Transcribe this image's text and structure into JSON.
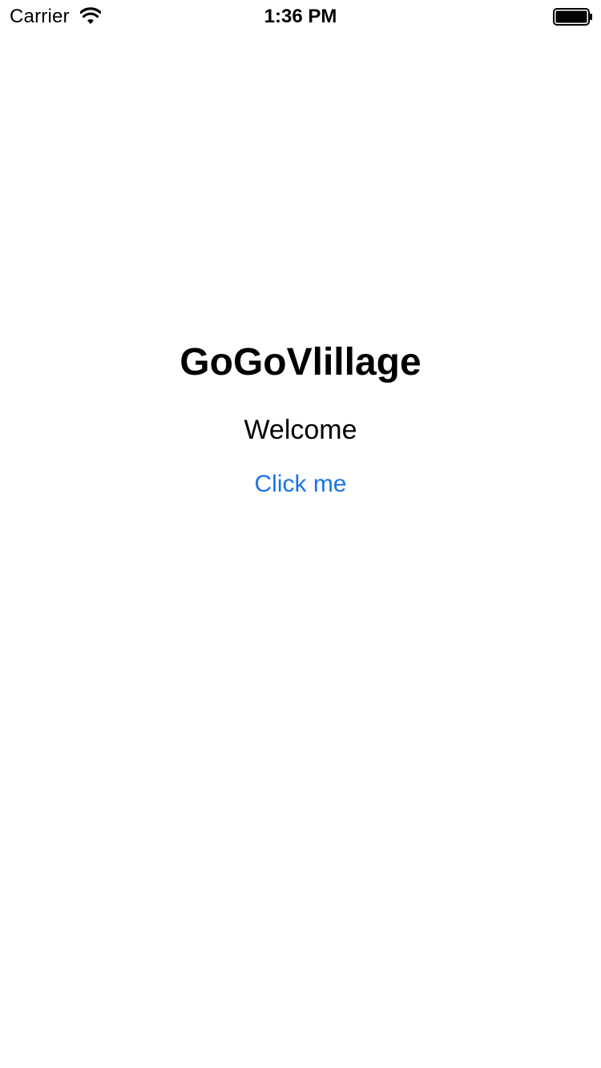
{
  "status_bar": {
    "carrier": "Carrier",
    "time": "1:36 PM",
    "wifi_icon": "wifi-icon",
    "battery_icon": "battery-icon",
    "battery_level": 1.0
  },
  "main": {
    "title": "GoGoVlillage",
    "subtitle": "Welcome",
    "button_label": "Click me"
  },
  "colors": {
    "background": "#ffffff",
    "text": "#000000",
    "accent": "#1a73e8"
  }
}
